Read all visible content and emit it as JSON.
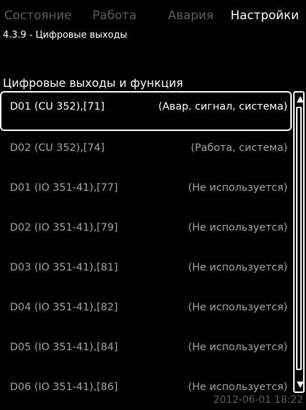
{
  "tabs": [
    {
      "label": "Состояние"
    },
    {
      "label": "Работа"
    },
    {
      "label": "Авария"
    },
    {
      "label": "Настройки"
    }
  ],
  "breadcrumb": "4.3.9 - Цифровые выходы",
  "section_title": "Цифровые выходы и функция",
  "rows": [
    {
      "name": "D01 (CU 352),[71]",
      "function": "(Авар. сигнал, система)"
    },
    {
      "name": "D02 (CU 352),[74]",
      "function": "(Работа, система)"
    },
    {
      "name": "D01 (IO 351-41),[77]",
      "function": "(Не используется)"
    },
    {
      "name": "D02 (IO 351-41),[79]",
      "function": "(Не используется)"
    },
    {
      "name": "D03 (IO 351-41),[81]",
      "function": "(Не используется)"
    },
    {
      "name": "D04 (IO 351-41),[82]",
      "function": "(Не используется)"
    },
    {
      "name": "D05 (IO 351-41),[84]",
      "function": "(Не используется)"
    },
    {
      "name": "D06 (IO 351-41),[86]",
      "function": "(Не используется)"
    }
  ],
  "timestamp": "2012-06-01 18:22",
  "colors": {
    "background": "#000000",
    "inactive_text": "#a3a3a3",
    "active_text": "#ffffff"
  }
}
